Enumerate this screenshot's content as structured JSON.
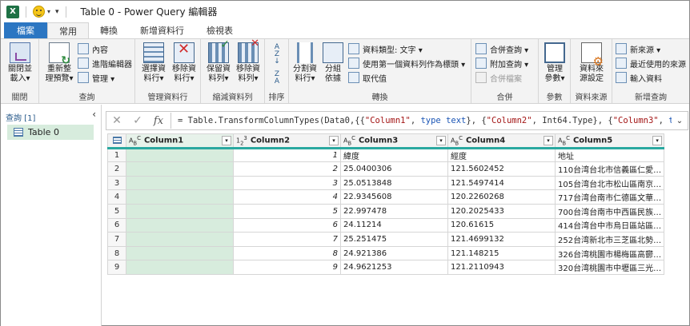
{
  "window": {
    "title": "Table 0 - Power Query 編輯器"
  },
  "tabs": [
    {
      "label": "檔案"
    },
    {
      "label": "常用"
    },
    {
      "label": "轉換"
    },
    {
      "label": "新增資料行"
    },
    {
      "label": "檢視表"
    }
  ],
  "ribbon": {
    "close": {
      "btn1": "關閉並",
      "btn2": "載入▾",
      "group": "關閉"
    },
    "query": {
      "refresh1": "重新整",
      "refresh2": "理預覽▾",
      "properties": "內容",
      "advanced": "進階編輯器",
      "manage": "管理 ▾",
      "group": "查詢"
    },
    "columns": {
      "choose1": "選擇資",
      "choose2": "料行▾",
      "remove1": "移除資",
      "remove2": "料行▾",
      "group": "管理資料行"
    },
    "rows": {
      "keep1": "保留資",
      "keep2": "料列▾",
      "remove1": "移除資",
      "remove2": "料列▾",
      "group": "縮減資料列"
    },
    "sort": {
      "group": "排序"
    },
    "transform": {
      "split1": "分割資",
      "split2": "料行▾",
      "groupby1": "分組",
      "groupby2": "依據",
      "datatype": "資料類型: 文字 ▾",
      "firstrow": "使用第一個資料列作為標頭 ▾",
      "replace": "取代值",
      "group": "轉換"
    },
    "combine": {
      "merge": "合併查詢 ▾",
      "append": "附加查詢 ▾",
      "files": "合併檔案",
      "group": "合併"
    },
    "params": {
      "manage1": "管理",
      "manage2": "參數▾",
      "group": "參數"
    },
    "datasource": {
      "settings1": "資料來",
      "settings2": "源設定",
      "group": "資料來源"
    },
    "newquery": {
      "newsource": "新來源 ▾",
      "recent": "最近使用的來源",
      "enter": "輸入資料",
      "group": "新增查詢"
    }
  },
  "querypane": {
    "header": "查詢 [1]",
    "items": [
      {
        "label": "Table 0"
      }
    ]
  },
  "formula": {
    "prefix": "= Table.TransformColumnTypes(Data0,{{",
    "parts": [
      {
        "t": "str",
        "v": "\"Column1\""
      },
      {
        "t": "plain",
        "v": ", "
      },
      {
        "t": "kw",
        "v": "type text"
      },
      {
        "t": "plain",
        "v": "}, {"
      },
      {
        "t": "str",
        "v": "\"Column2\""
      },
      {
        "t": "plain",
        "v": ", Int64.Type}, {"
      },
      {
        "t": "str",
        "v": "\"Column3\""
      },
      {
        "t": "plain",
        "v": ", "
      },
      {
        "t": "kw",
        "v": "type text"
      },
      {
        "t": "plain",
        "v": "},"
      }
    ]
  },
  "grid": {
    "columns": [
      {
        "type_top": "A",
        "type_sub": "B",
        "type_sup": "C",
        "name": "Column1"
      },
      {
        "type_top": "1",
        "type_sub": "2",
        "type_sup": "3",
        "name": "Column2"
      },
      {
        "type_top": "A",
        "type_sub": "B",
        "type_sup": "C",
        "name": "Column3"
      },
      {
        "type_top": "A",
        "type_sub": "B",
        "type_sup": "C",
        "name": "Column4"
      },
      {
        "type_top": "A",
        "type_sub": "B",
        "type_sup": "C",
        "name": "Column5"
      }
    ],
    "rows": [
      {
        "n": "1",
        "c1": "",
        "c2": "1",
        "c3": "緯度",
        "c4": "經度",
        "c5": "地址"
      },
      {
        "n": "2",
        "c1": "",
        "c2": "2",
        "c3": "25.0400306",
        "c4": "121.5602452",
        "c5": "110台湾台北市信義區仁愛…"
      },
      {
        "n": "3",
        "c1": "",
        "c2": "3",
        "c3": "25.0513848",
        "c4": "121.5497414",
        "c5": "105台湾台北市松山區南京…"
      },
      {
        "n": "4",
        "c1": "",
        "c2": "4",
        "c3": "22.9345608",
        "c4": "120.2260268",
        "c5": "717台湾台南市仁德區文華…"
      },
      {
        "n": "5",
        "c1": "",
        "c2": "5",
        "c3": "22.997478",
        "c4": "120.2025433",
        "c5": "700台湾台南市中西區民族…"
      },
      {
        "n": "6",
        "c1": "",
        "c2": "6",
        "c3": "24.11214",
        "c4": "120.61615",
        "c5": "414台湾台中市烏日區站區…"
      },
      {
        "n": "7",
        "c1": "",
        "c2": "7",
        "c3": "25.251475",
        "c4": "121.4699132",
        "c5": "252台湾新北市三芝區北勢…"
      },
      {
        "n": "8",
        "c1": "",
        "c2": "8",
        "c3": "24.921386",
        "c4": "121.148215",
        "c5": "326台湾桃園市楊梅區高鬱…"
      },
      {
        "n": "9",
        "c1": "",
        "c2": "9",
        "c3": "24.9621253",
        "c4": "121.2110943",
        "c5": "320台湾桃園市中壢區三光…"
      }
    ]
  }
}
